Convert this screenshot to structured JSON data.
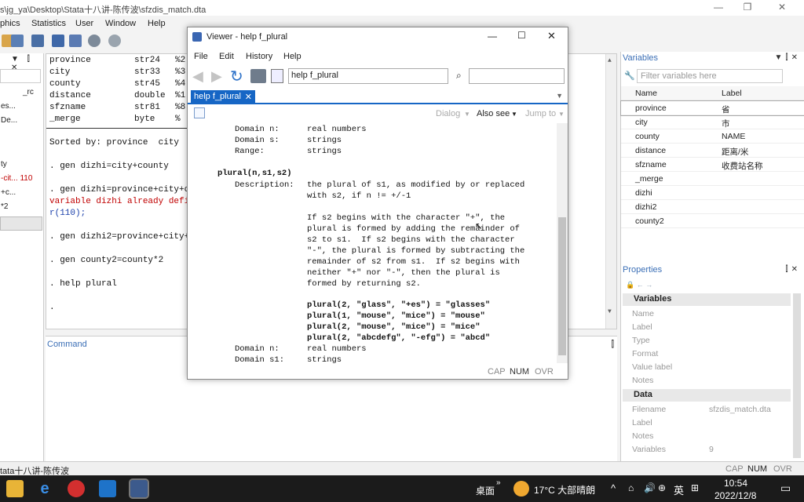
{
  "app": {
    "title": "s\\jg_ya\\Desktop\\Stata十八讲-陈传波\\sfzdis_match.dta",
    "menu": [
      "phics",
      "Statistics",
      "User",
      "Window",
      "Help"
    ]
  },
  "left_panel": {
    "items": [
      "_rc",
      "es...",
      "De...",
      "ty",
      "-cit... 110",
      "+c...",
      "*2"
    ]
  },
  "results": {
    "vars": [
      {
        "name": "province",
        "type": "str24",
        "fmt": "%2"
      },
      {
        "name": "city",
        "type": "str33",
        "fmt": "%3"
      },
      {
        "name": "county",
        "type": "str45",
        "fmt": "%4"
      },
      {
        "name": "distance",
        "type": "double",
        "fmt": "%1"
      },
      {
        "name": "sfzname",
        "type": "str81",
        "fmt": "%8"
      },
      {
        "name": "_merge",
        "type": "byte",
        "fmt": "%"
      }
    ],
    "sorted": "Sorted by: province  city",
    "cmd1": ". gen dizhi=city+county",
    "cmd2": ". gen dizhi=province+city+c",
    "err1": "variable dizhi already defi",
    "err2": "r(110);",
    "cmd3": ". gen dizhi2=province+city+",
    "cmd4": ". gen county2=county*2",
    "cmd5": ". help plural",
    "cmd6": "."
  },
  "command": {
    "label": "Command"
  },
  "variables_panel": {
    "title": "Variables",
    "filter_placeholder": "Filter variables here",
    "col_name": "Name",
    "col_label": "Label",
    "rows": [
      {
        "name": "province",
        "label": "省"
      },
      {
        "name": "city",
        "label": "市"
      },
      {
        "name": "county",
        "label": "NAME"
      },
      {
        "name": "distance",
        "label": "距离/米"
      },
      {
        "name": "sfzname",
        "label": "收费站名称"
      },
      {
        "name": "_merge",
        "label": ""
      },
      {
        "name": "dizhi",
        "label": ""
      },
      {
        "name": "dizhi2",
        "label": ""
      },
      {
        "name": "county2",
        "label": ""
      }
    ]
  },
  "properties_panel": {
    "title": "Properties",
    "sec_vars": "Variables",
    "var_rows": [
      "Name",
      "Label",
      "Type",
      "Format",
      "Value label",
      "Notes"
    ],
    "sec_data": "Data",
    "data_rows": [
      {
        "k": "Filename",
        "v": "sfzdis_match.dta"
      },
      {
        "k": "Label",
        "v": ""
      },
      {
        "k": "Notes",
        "v": ""
      },
      {
        "k": "Variables",
        "v": "9"
      }
    ]
  },
  "status": {
    "left": "tata十八讲-陈传波",
    "cap": "CAP",
    "num": "NUM",
    "ovr": "OVR"
  },
  "viewer": {
    "title": "Viewer - help f_plural",
    "menu": [
      "File",
      "Edit",
      "History",
      "Help"
    ],
    "url": "help f_plural",
    "tab": "help f_plural",
    "dialog": "Dialog",
    "also_see": "Also see",
    "jump_to": "Jump to",
    "content": {
      "d1k": "Domain n:",
      "d1v": "real numbers",
      "d2k": "Domain s:",
      "d2v": "strings",
      "d3k": "Range:",
      "d3v": "strings",
      "func": "plural(n,s1,s2)",
      "desc_k": "Description:",
      "desc1": "the plural of s1, as modified by or replaced",
      "desc2": "with s2, if n != +/-1",
      "p1": "If s2 begins with the character \"+\", the",
      "p2": "plural is formed by adding the remainder of",
      "p3": "s2 to s1.  If s2 begins with the character",
      "p4": "\"-\", the plural is formed by subtracting the",
      "p5": "remainder of s2 from s1.  If s2 begins with",
      "p6": "neither \"+\" nor \"-\", then the plural is",
      "p7": "formed by returning s2.",
      "e1": "plural(2, \"glass\", \"+es\") = \"glasses\"",
      "e2": "plural(1, \"mouse\", \"mice\") = \"mouse\"",
      "e3": "plural(2, \"mouse\", \"mice\") = \"mice\"",
      "e4": "plural(2, \"abcdefg\", \"-efg\") = \"abcd\"",
      "d4k": "Domain n:",
      "d4v": "real numbers",
      "d5k": "Domain s1:",
      "d5v": "strings"
    },
    "status": {
      "cap": "CAP",
      "num": "NUM",
      "ovr": "OVR"
    }
  },
  "taskbar": {
    "desktop": "桌面",
    "weather": "17°C 大部晴朗",
    "ime": "英",
    "time": "10:54",
    "date": "2022/12/8"
  }
}
